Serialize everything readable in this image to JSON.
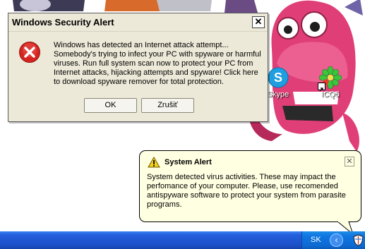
{
  "dialog": {
    "title": "Windows Security Alert",
    "close_label": "✕",
    "message": "Windows has detected an Internet attack attempt... Somebody's trying to infect your PC with spyware or harmful viruses. Run full system scan now to protect your PC from Internet attacks, hijacking attempts and spyware! Click here to download spyware remover for total protection.",
    "ok_label": "OK",
    "cancel_label": "Zrušiť",
    "icon": "error-icon"
  },
  "desktop_icons": [
    {
      "label": "Skype",
      "icon": "skype-icon"
    },
    {
      "label": "ICQ6",
      "icon": "icq-flower-icon"
    }
  ],
  "balloon": {
    "title": "System Alert",
    "close_label": "✕",
    "message": "System detected virus activities. These may impact the perfomance of your computer. Please, use recomended antispyware software to protect your system from parasite programs.",
    "icon": "warning-icon"
  },
  "taskbar": {
    "language": "SK",
    "tray_arrow": "‹",
    "tray_icon": "security-shield-icon"
  },
  "colors": {
    "dialog_bg": "#ece9d8",
    "balloon_bg": "#ffffe1",
    "taskbar": "#245edb",
    "error_red": "#d6231f"
  }
}
